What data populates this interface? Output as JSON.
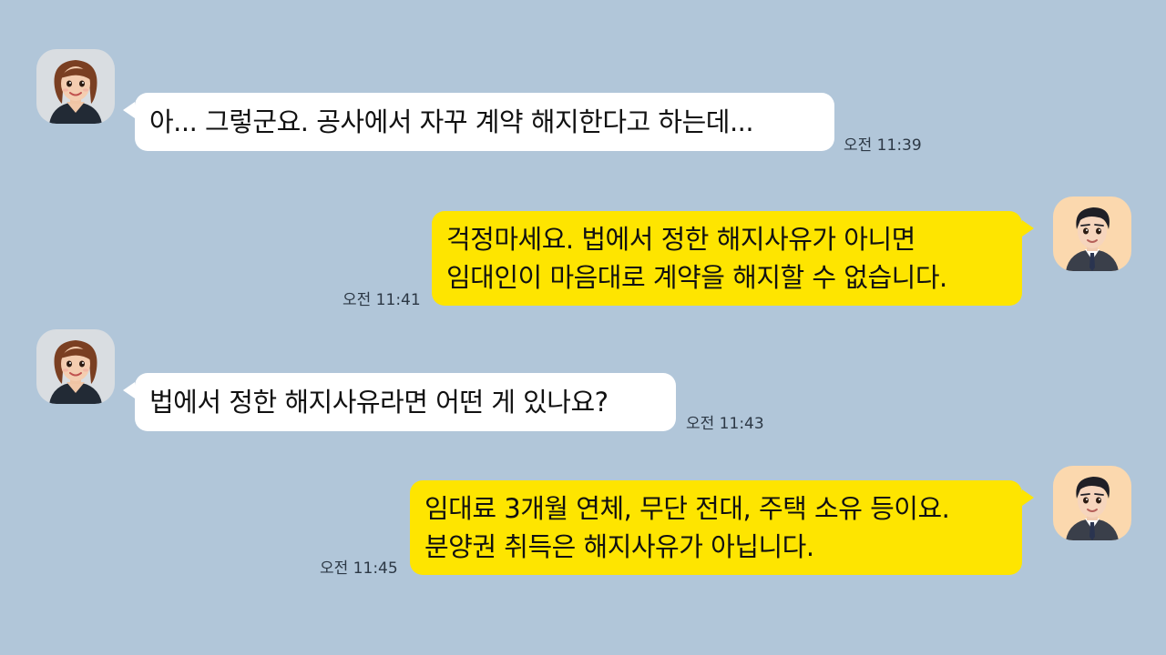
{
  "theme": {
    "background": "#b1c6d9",
    "incoming_bubble": "#ffffff",
    "outgoing_bubble": "#fee500"
  },
  "messages": [
    {
      "sender": "woman",
      "side": "left",
      "lines": [
        "아... 그렇군요. 공사에서 자꾸 계약 해지한다고 하는데..."
      ],
      "time": "오전 11:39"
    },
    {
      "sender": "man",
      "side": "right",
      "lines": [
        "걱정마세요. 법에서 정한 해지사유가 아니면",
        "임대인이 마음대로 계약을 해지할 수 없습니다."
      ],
      "time": "오전 11:41"
    },
    {
      "sender": "woman",
      "side": "left",
      "lines": [
        "법에서 정한 해지사유라면 어떤 게 있나요?"
      ],
      "time": "오전 11:43"
    },
    {
      "sender": "man",
      "side": "right",
      "lines": [
        "임대료 3개월 연체, 무단 전대, 주택 소유 등이요.",
        "분양권 취득은 해지사유가 아닙니다."
      ],
      "time": "오전 11:45"
    }
  ]
}
